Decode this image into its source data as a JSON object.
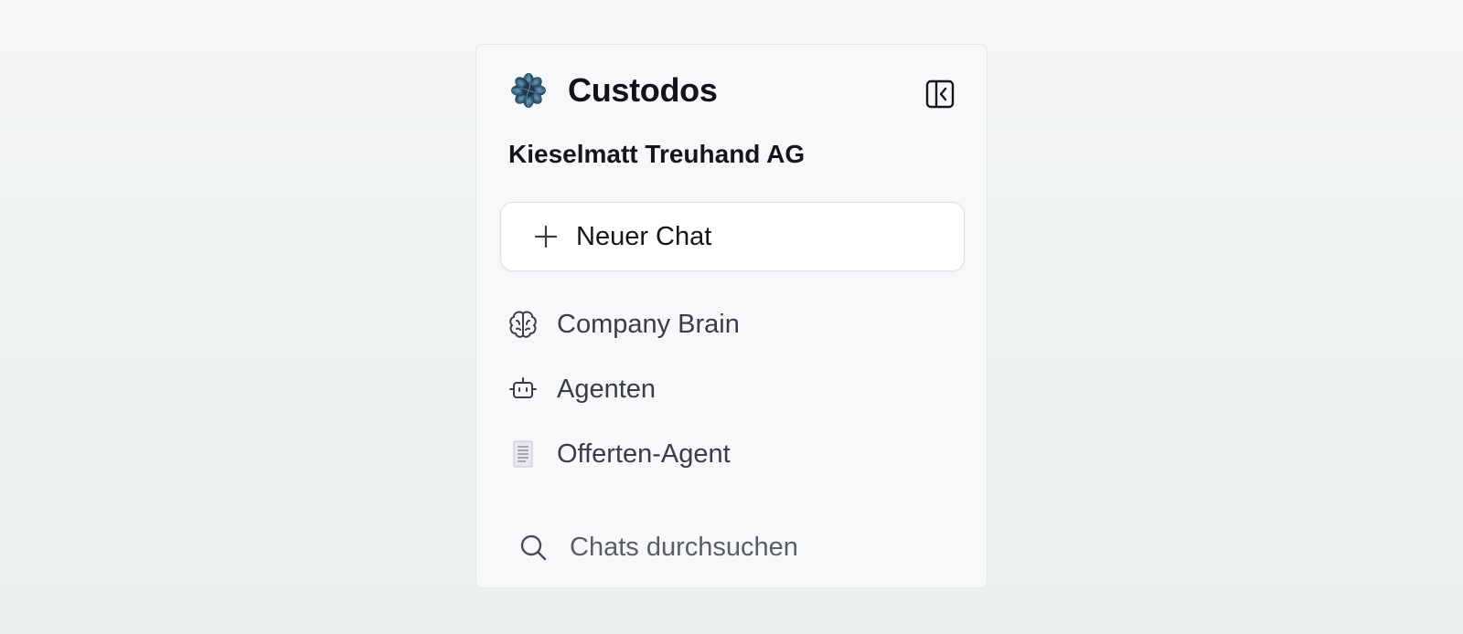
{
  "app": {
    "name": "Custodos",
    "logo_icon": "custodos-logo-icon",
    "collapse_icon": "sidebar-collapse-icon"
  },
  "organization": {
    "name": "Kieselmatt Treuhand AG"
  },
  "new_chat": {
    "label": "Neuer Chat",
    "icon": "plus-icon"
  },
  "nav": {
    "items": [
      {
        "label": "Company Brain",
        "icon": "brain-icon"
      },
      {
        "label": "Agenten",
        "icon": "robot-icon"
      },
      {
        "label": "Offerten-Agent",
        "icon": "document-icon"
      }
    ]
  },
  "search": {
    "label": "Chats durchsuchen",
    "icon": "search-icon"
  },
  "colors": {
    "text_primary": "#14161a",
    "text_secondary": "#3a3d42",
    "panel_background": "#f7f8fa",
    "logo_blue": "#2a4f6a"
  }
}
